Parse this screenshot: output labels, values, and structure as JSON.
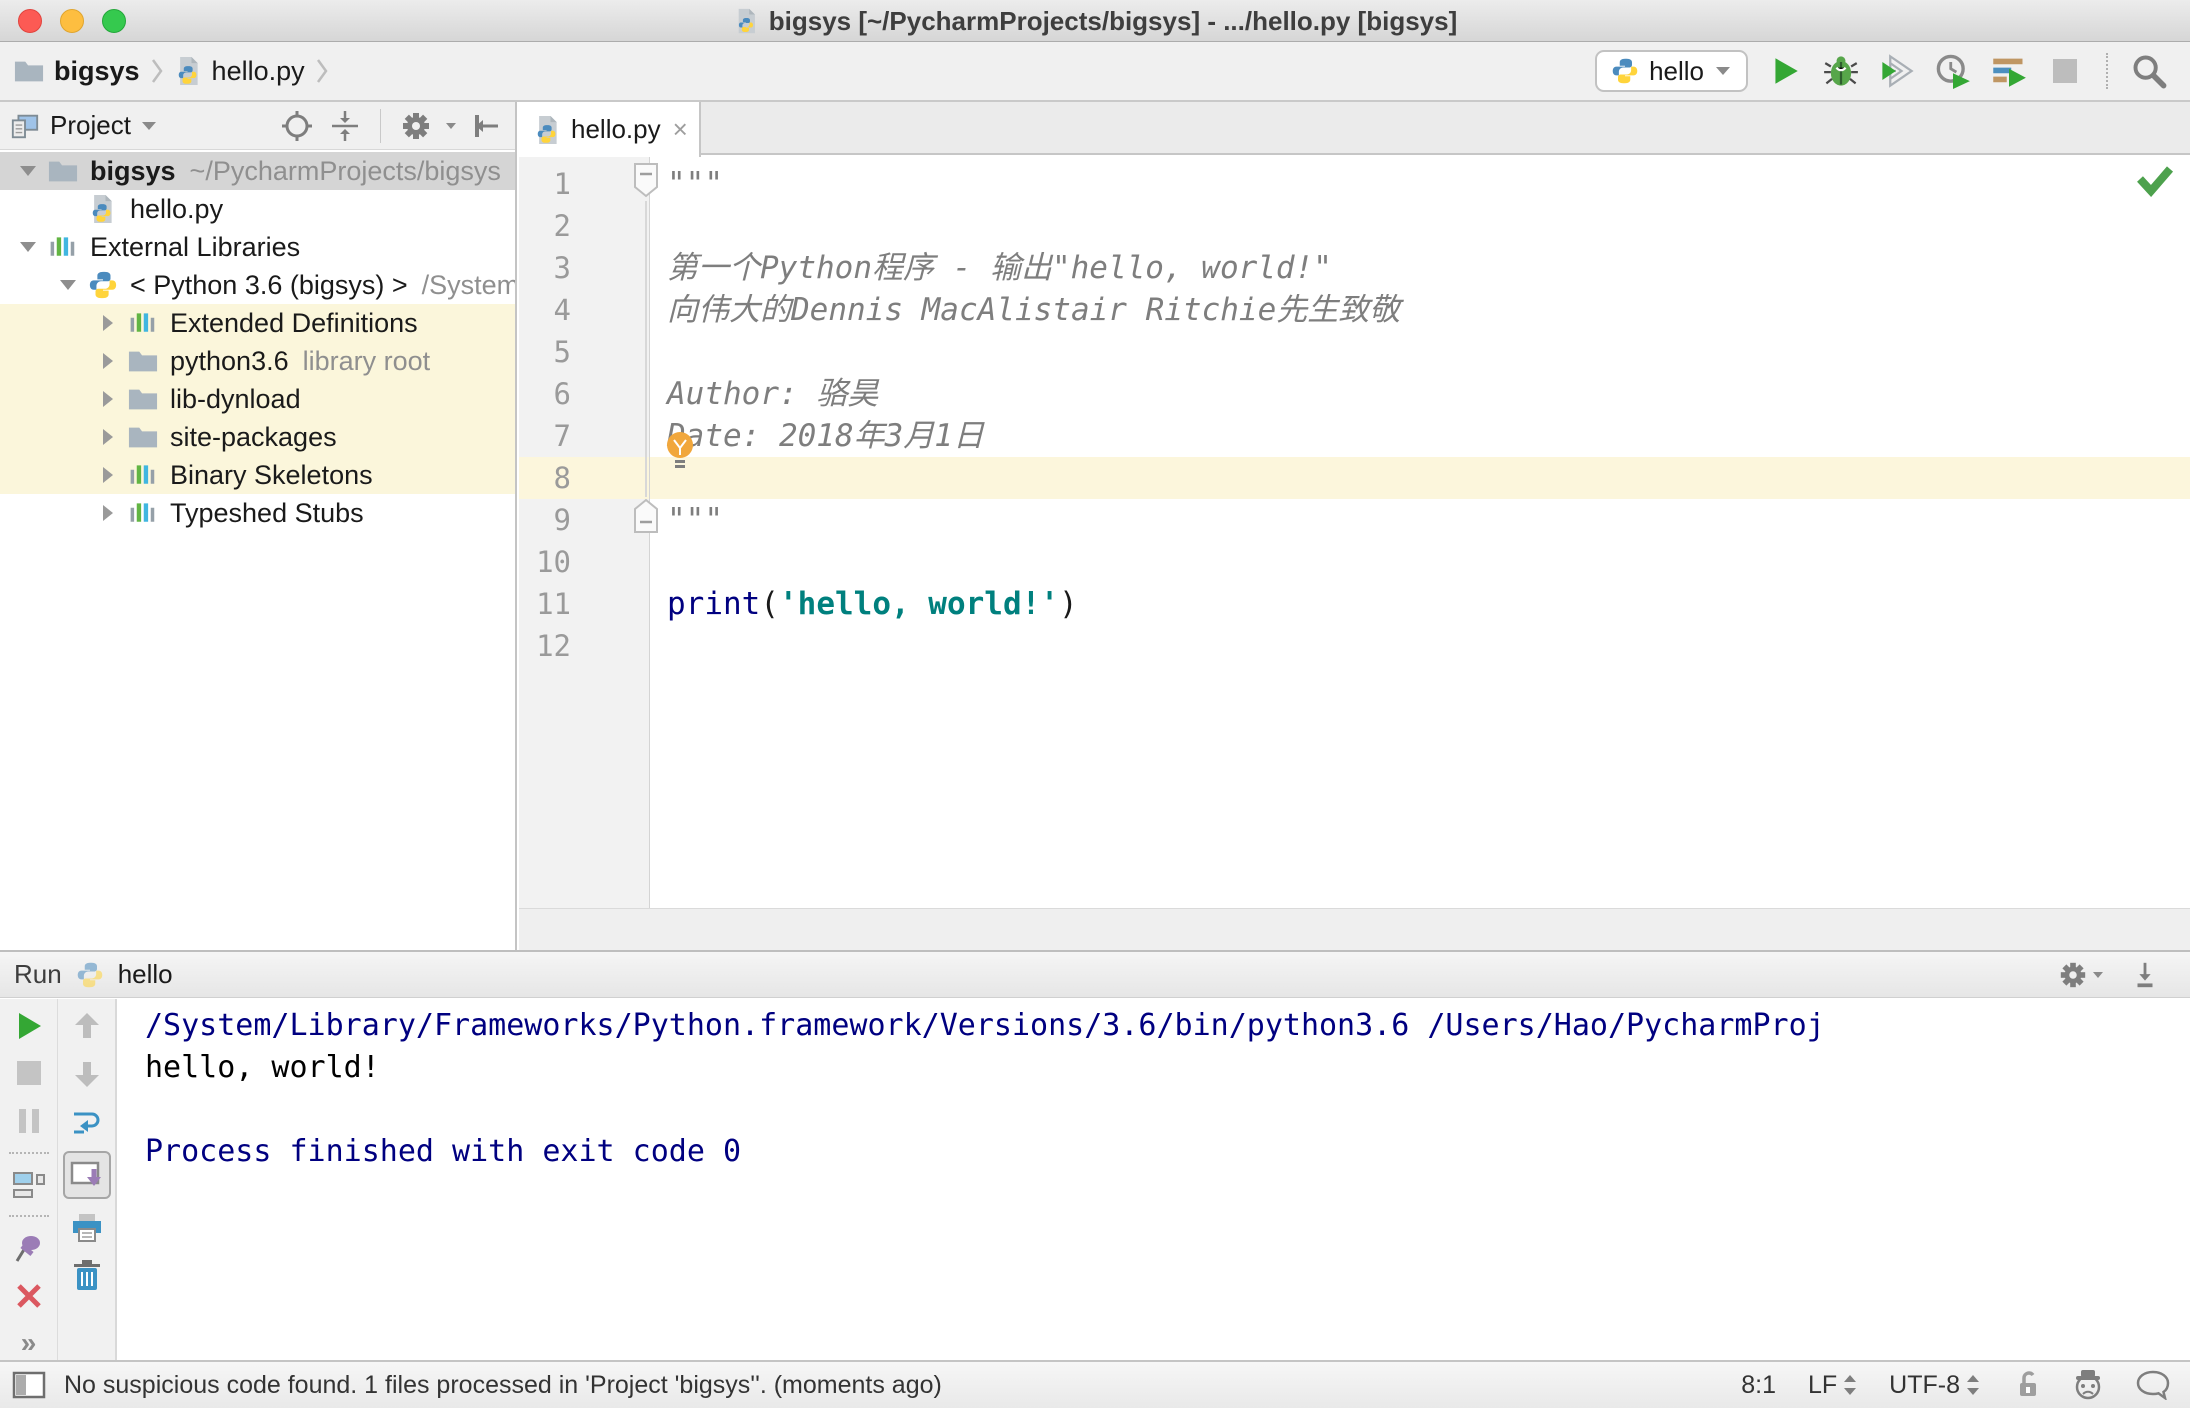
{
  "window": {
    "title": "bigsys [~/PycharmProjects/bigsys] - .../hello.py [bigsys]"
  },
  "breadcrumbs": {
    "project": "bigsys",
    "file": "hello.py"
  },
  "run_widget": {
    "config": "hello"
  },
  "project_panel": {
    "title": "Project",
    "tree": [
      {
        "label": "bigsys",
        "suffix": "~/PycharmProjects/bigsys"
      },
      {
        "label": "hello.py"
      },
      {
        "label": "External Libraries"
      },
      {
        "label": "< Python 3.6 (bigsys) >",
        "suffix": "/System"
      },
      {
        "label": "Extended Definitions"
      },
      {
        "label": "python3.6",
        "suffix": "library root"
      },
      {
        "label": "lib-dynload"
      },
      {
        "label": "site-packages"
      },
      {
        "label": "Binary Skeletons"
      },
      {
        "label": "Typeshed Stubs"
      }
    ]
  },
  "editor": {
    "tab": "hello.py",
    "lines": [
      {
        "n": "1",
        "t": "\"\"\""
      },
      {
        "n": "2",
        "t": ""
      },
      {
        "n": "3",
        "t": "第一个Python程序 - 输出\"hello, world!\""
      },
      {
        "n": "4",
        "t": "向伟大的Dennis MacAlistair Ritchie先生致敬"
      },
      {
        "n": "5",
        "t": ""
      },
      {
        "n": "6",
        "t": "Author: 骆昊"
      },
      {
        "n": "7",
        "t": "Date: 2018年3月1日"
      },
      {
        "n": "8",
        "t": ""
      },
      {
        "n": "9",
        "t": "\"\"\""
      },
      {
        "n": "10",
        "t": ""
      },
      {
        "n": "11",
        "t": ""
      },
      {
        "n": "12",
        "t": ""
      }
    ],
    "print_line": {
      "keyword": "print",
      "open_paren": "(",
      "string": "'hello, world!'",
      "close_paren": ")"
    }
  },
  "run_panel": {
    "label": "Run",
    "tab": "hello",
    "more": "»",
    "console": [
      "/System/Library/Frameworks/Python.framework/Versions/3.6/bin/python3.6 /Users/Hao/PycharmProj",
      "hello, world!",
      "",
      "Process finished with exit code 0"
    ]
  },
  "statusbar": {
    "message": "No suspicious code found. 1 files processed in 'Project 'bigsys''. (moments ago)",
    "caret": "8:1",
    "line_ending": "LF",
    "encoding": "UTF-8"
  },
  "colors": {
    "keyword": "#000080",
    "string": "#00807E",
    "docstring": "#7E7E7E",
    "console_info": "#000080",
    "console_stdout": "#000000",
    "current_line": "#FCF6DC",
    "library_row_highlight": "#FBF6DB",
    "selected_row": "#D5D5D5",
    "run_green": "#34A734",
    "inspection_ok_green": "#4DA14D"
  }
}
